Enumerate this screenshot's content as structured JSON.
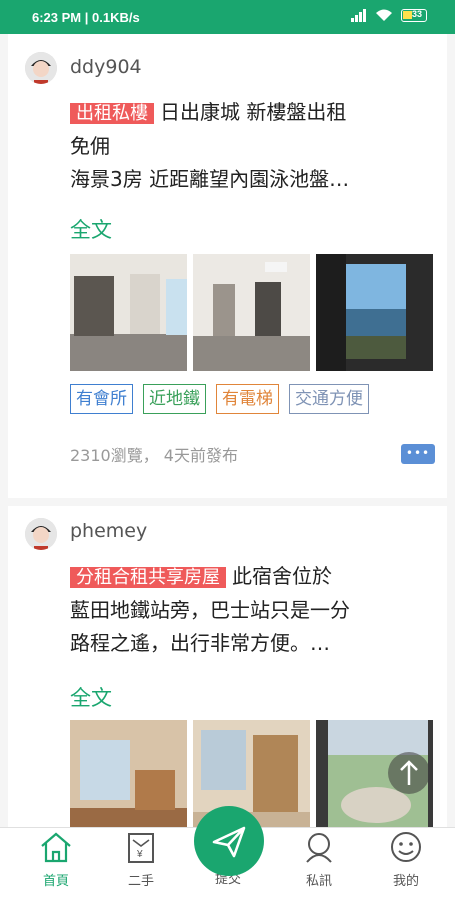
{
  "status_bar": {
    "time_speed": "6:23 PM | 0.1KB/s",
    "battery": "33"
  },
  "colors": {
    "brand": "#1aa66f",
    "tag_red": "#ef5a5a"
  },
  "posts": [
    {
      "username": "ddy904",
      "tag": "出租私樓",
      "title_line1": "日出康城 新樓盤出租",
      "title_line2": "免佣",
      "title_line3": "海景3房 近距離望內園泳池盤…",
      "full_text": "全文",
      "chips": [
        {
          "label": "有會所",
          "color": "#3f7fd0"
        },
        {
          "label": "近地鐵",
          "color": "#3aa05a"
        },
        {
          "label": "有電梯",
          "color": "#e0853a"
        },
        {
          "label": "交通方便",
          "color": "#7f93b5"
        }
      ],
      "meta": "2310瀏覽， 4天前發布",
      "more": "•••"
    },
    {
      "username": "phemey",
      "tag": "分租合租共享房屋",
      "title_line1": "此宿舍位於",
      "title_line2": "藍田地鐵站旁，巴士站只是一分",
      "title_line3": "路程之遙，出行非常方便。…",
      "full_text": "全文"
    }
  ],
  "tabs": [
    {
      "label": "首頁",
      "icon": "home-icon",
      "active": true
    },
    {
      "label": "二手",
      "icon": "secondhand-icon"
    },
    {
      "label": "提交",
      "icon": "send-icon"
    },
    {
      "label": "私訊",
      "icon": "message-icon"
    },
    {
      "label": "我的",
      "icon": "profile-icon"
    }
  ]
}
